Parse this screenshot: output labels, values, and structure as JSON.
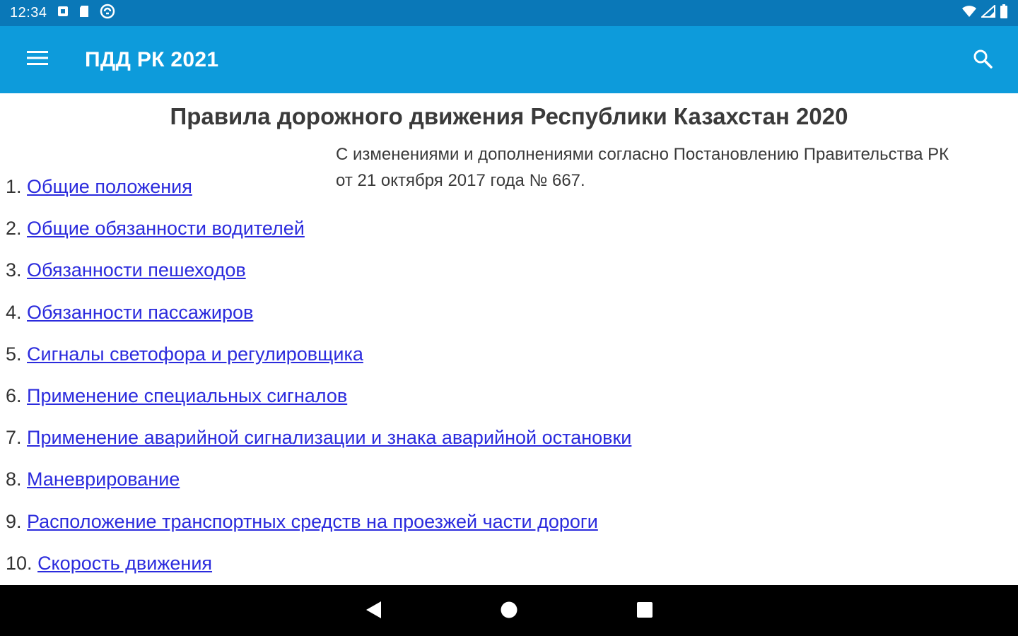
{
  "status_bar": {
    "time": "12:34",
    "left_icons": [
      "notification-icon",
      "sd-card-icon",
      "sync-icon"
    ],
    "right_icons": [
      "wifi-icon",
      "cellular-signal-icon",
      "battery-icon"
    ]
  },
  "app_bar": {
    "title": "ПДД РК 2021",
    "menu_icon": "hamburger-menu-icon",
    "search_icon": "search-icon",
    "color": "#0d9bdb"
  },
  "document": {
    "title": "Правила дорожного движения Республики Казахстан 2020",
    "note_line1": "С изменениями и дополнениями согласно Постановлению Правительства РК",
    "note_line2": "от 21 октября 2017 года № 667.",
    "toc": [
      {
        "number": "1.",
        "label": "Общие положения"
      },
      {
        "number": "2.",
        "label": "Общие обязанности водителей"
      },
      {
        "number": "3.",
        "label": "Обязанности пешеходов"
      },
      {
        "number": "4.",
        "label": "Обязанности пассажиров"
      },
      {
        "number": "5.",
        "label": "Сигналы светофора и регулировщика"
      },
      {
        "number": "6.",
        "label": "Применение специальных сигналов"
      },
      {
        "number": "7.",
        "label": "Применение аварийной сигнализации и знака аварийной остановки"
      },
      {
        "number": "8.",
        "label": "Маневрирование"
      },
      {
        "number": "9.",
        "label": "Расположение транспортных средств на проезжей части дороги"
      },
      {
        "number": "10.",
        "label": "Скорость движения"
      }
    ],
    "link_color": "#2b2bdd"
  },
  "nav_bar": {
    "icons": [
      "back-icon",
      "home-icon",
      "recents-icon"
    ]
  }
}
